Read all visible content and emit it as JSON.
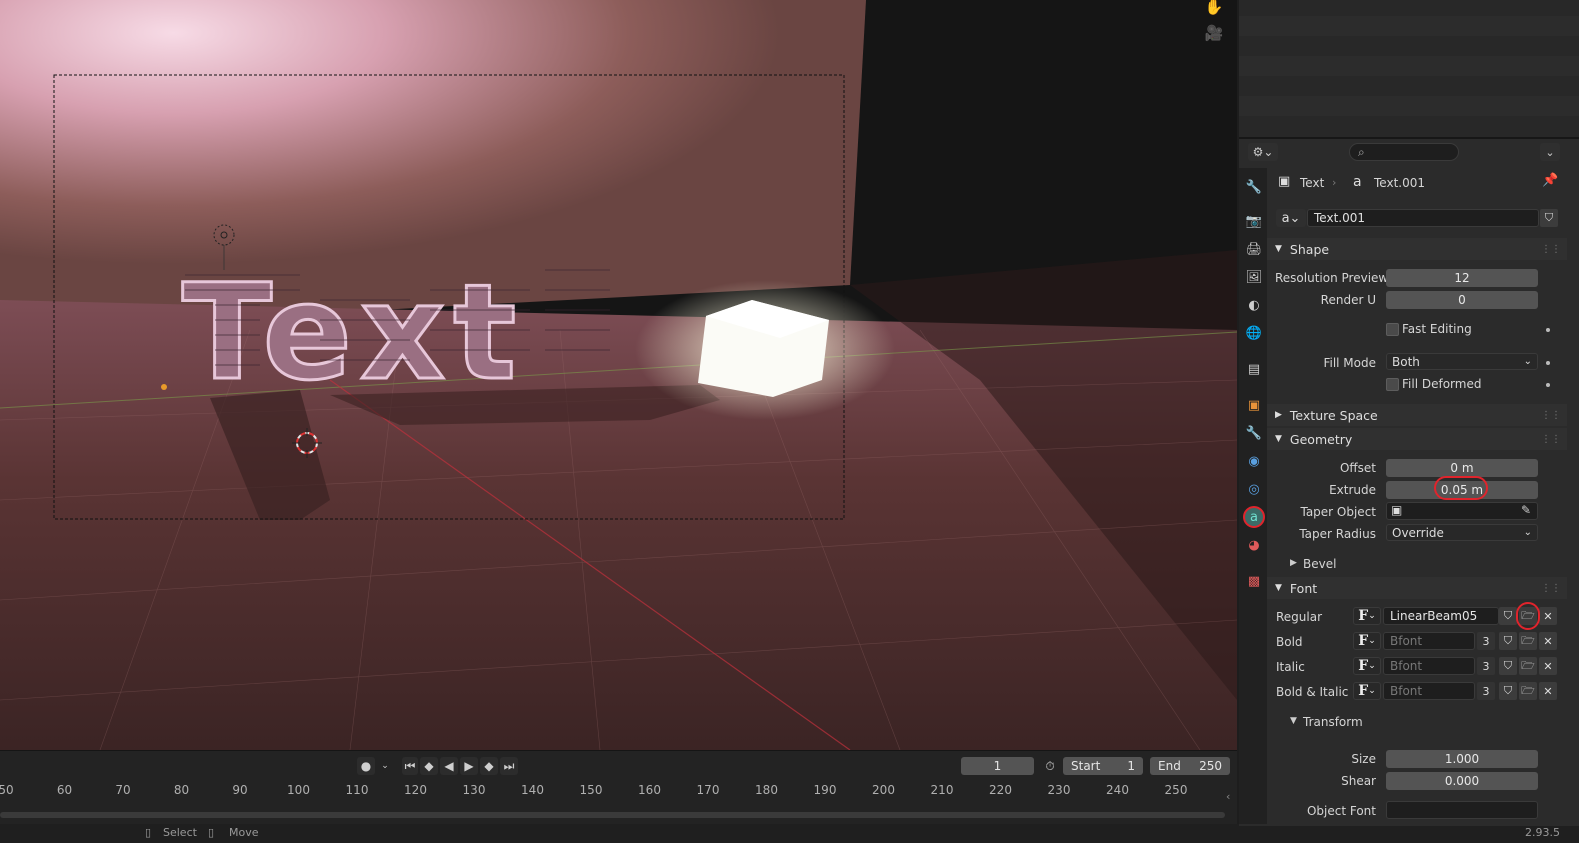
{
  "viewport": {
    "scene_text": "Text",
    "nav_icons": [
      "hand-icon",
      "camera-icon"
    ]
  },
  "timeline": {
    "current_frame": "1",
    "start_label": "Start",
    "start_value": "1",
    "end_label": "End",
    "end_value": "250",
    "ruler": [
      "50",
      "60",
      "70",
      "80",
      "90",
      "100",
      "110",
      "120",
      "130",
      "140",
      "150",
      "160",
      "170",
      "180",
      "190",
      "200",
      "210",
      "220",
      "230",
      "240",
      "250"
    ]
  },
  "statusbar": {
    "select_label": "Select",
    "move_label": "Move",
    "version": "2.93.5"
  },
  "properties": {
    "breadcrumb_object": "Text",
    "breadcrumb_data": "Text.001",
    "datablock_name": "Text.001",
    "shape": {
      "title": "Shape",
      "resolution_preview_label": "Resolution Preview...",
      "resolution_preview_value": "12",
      "render_u_label": "Render U",
      "render_u_value": "0",
      "fast_editing_label": "Fast Editing",
      "fill_mode_label": "Fill Mode",
      "fill_mode_value": "Both",
      "fill_deformed_label": "Fill Deformed"
    },
    "texture_space": {
      "title": "Texture Space"
    },
    "geometry": {
      "title": "Geometry",
      "offset_label": "Offset",
      "offset_value": "0 m",
      "extrude_label": "Extrude",
      "extrude_value": "0.05 m",
      "taper_object_label": "Taper Object",
      "taper_radius_label": "Taper Radius",
      "taper_radius_value": "Override",
      "bevel_title": "Bevel"
    },
    "font": {
      "title": "Font",
      "rows": [
        {
          "label": "Regular",
          "value": "LinearBeam05",
          "users": ""
        },
        {
          "label": "Bold",
          "value": "Bfont",
          "users": "3"
        },
        {
          "label": "Italic",
          "value": "Bfont",
          "users": "3"
        },
        {
          "label": "Bold & Italic",
          "value": "Bfont",
          "users": "3"
        }
      ],
      "f_glyph": "F",
      "transform_title": "Transform",
      "size_label": "Size",
      "size_value": "1.000",
      "shear_label": "Shear",
      "shear_value": "0.000",
      "object_font_label": "Object Font"
    }
  },
  "colors": {
    "accent_annotation": "#e0242c",
    "active_tab": "#4a8a82",
    "field_bg": "#545454"
  }
}
